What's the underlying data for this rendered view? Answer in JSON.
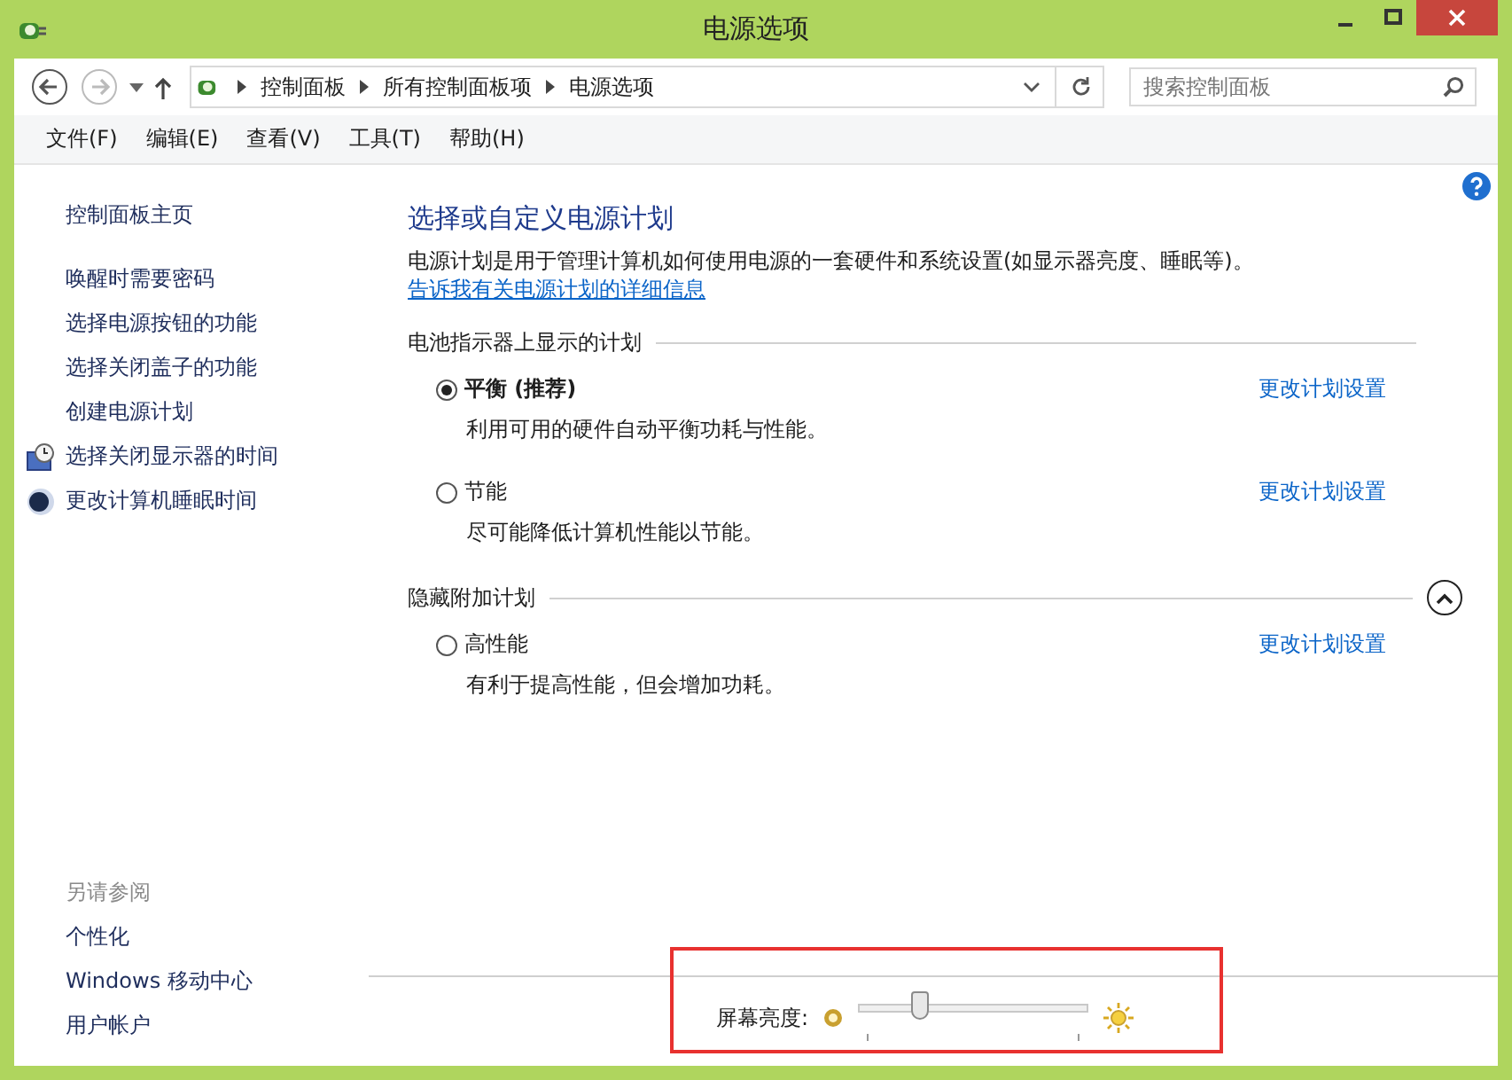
{
  "window": {
    "title": "电源选项"
  },
  "address": {
    "crumbs": [
      "控制面板",
      "所有控制面板项",
      "电源选项"
    ]
  },
  "search": {
    "placeholder": "搜索控制面板"
  },
  "menu": [
    "文件(F)",
    "编辑(E)",
    "查看(V)",
    "工具(T)",
    "帮助(H)"
  ],
  "sidebar": {
    "home": "控制面板主页",
    "items": [
      {
        "label": "唤醒时需要密码",
        "kind": "plain"
      },
      {
        "label": "选择电源按钮的功能",
        "kind": "plain"
      },
      {
        "label": "选择关闭盖子的功能",
        "kind": "plain"
      },
      {
        "label": "创建电源计划",
        "kind": "plain"
      },
      {
        "label": "选择关闭显示器的时间",
        "kind": "display"
      },
      {
        "label": "更改计算机睡眠时间",
        "kind": "sleep"
      }
    ],
    "see_also_title": "另请参阅",
    "see_also": [
      "个性化",
      "Windows 移动中心",
      "用户帐户"
    ]
  },
  "main": {
    "title": "选择或自定义电源计划",
    "description": "电源计划是用于管理计算机如何使用电源的一套硬件和系统设置(如显示器亮度、睡眠等)。",
    "link": "告诉我有关电源计划的详细信息",
    "sections": [
      {
        "title": "电池指示器上显示的计划",
        "plans": [
          {
            "name": "平衡 (推荐)",
            "selected": true,
            "description": "利用可用的硬件自动平衡功耗与性能。",
            "action": "更改计划设置"
          },
          {
            "name": "节能",
            "selected": false,
            "description": "尽可能降低计算机性能以节能。",
            "action": "更改计划设置"
          }
        ]
      },
      {
        "title": "隐藏附加计划",
        "expanded": true,
        "plans": [
          {
            "name": "高性能",
            "selected": false,
            "description": "有利于提高性能，但会增加功耗。",
            "action": "更改计划设置"
          }
        ]
      }
    ]
  },
  "brightness": {
    "label": "屏幕亮度:",
    "level": 0.27
  }
}
